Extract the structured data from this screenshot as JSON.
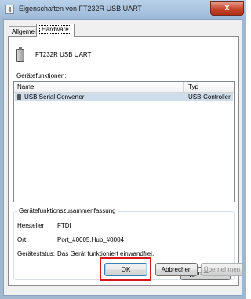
{
  "window": {
    "title": "Eigenschaften von FT232R USB UART",
    "close_glyph": "x"
  },
  "tabs": [
    {
      "label": "Allgemein"
    },
    {
      "label": "Hardware"
    }
  ],
  "device": {
    "icon": "usb-device-icon",
    "name": "FT232R USB UART"
  },
  "functions": {
    "label": "Gerätefunktionen:",
    "columns": [
      "Name",
      "Typ"
    ],
    "rows": [
      {
        "name": "USB Serial Converter",
        "type": "USB-Controller",
        "icon": "usb-plug-icon"
      }
    ]
  },
  "summary": {
    "title": "Gerätefunktionszusammenfassung",
    "manufacturer_label": "Hersteller:",
    "manufacturer": "FTDI",
    "location_label": "Ort:",
    "location": "Port_#0005.Hub_#0004",
    "status_label": "Gerätestatus:",
    "status": "Das Gerät funktioniert einwandfrei."
  },
  "buttons": {
    "properties_pre": "E",
    "properties_ul": "i",
    "properties_post": "genschaften",
    "ok": "OK",
    "cancel": "Abbrechen",
    "apply_ul": "Ü",
    "apply_post": "bernehmen"
  },
  "colors": {
    "highlight": "#d8161e",
    "selection": "#cfdcec",
    "close_button": "#c7452c"
  }
}
